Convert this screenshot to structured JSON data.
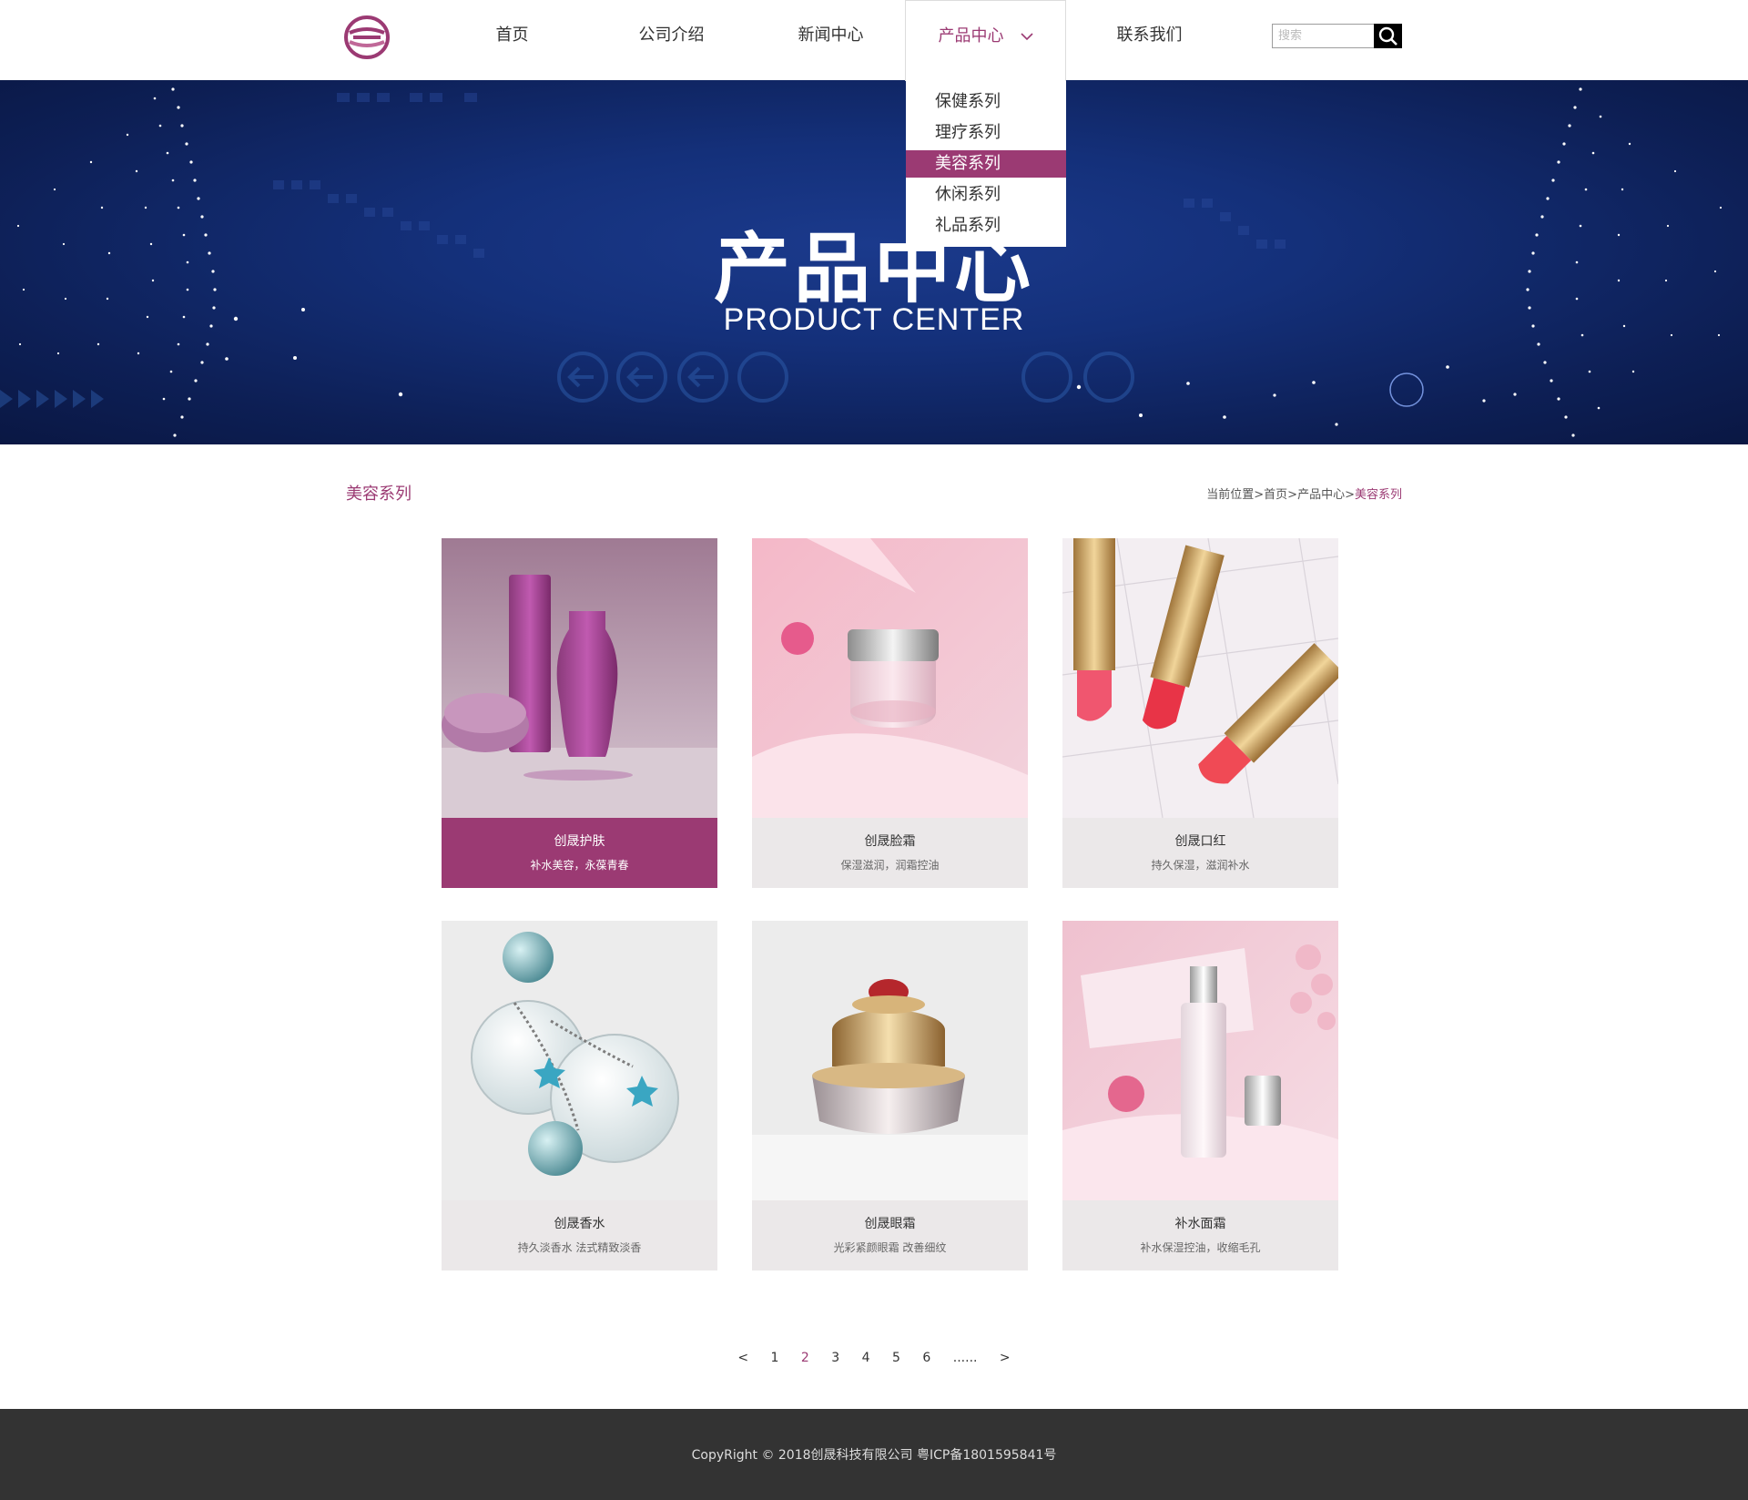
{
  "header": {
    "nav": [
      "首页",
      "公司介绍",
      "新闻中心",
      "产品中心",
      "联系我们"
    ],
    "active_nav": "产品中心",
    "search_placeholder": "搜索"
  },
  "dropdown": {
    "items": [
      "保健系列",
      "理疗系列",
      "美容系列",
      "休闲系列",
      "礼品系列"
    ],
    "active": "美容系列"
  },
  "banner": {
    "title": "产品中心",
    "subtitle": "PRODUCT CENTER"
  },
  "section": {
    "title": "美容系列",
    "breadcrumb": {
      "prefix": "当前位置",
      "sep": ">",
      "home": "首页",
      "parent": "产品中心",
      "current": "美容系列"
    }
  },
  "products": [
    {
      "name": "创晟护肤",
      "desc": "补水美容，永葆青春"
    },
    {
      "name": "创晟脸霜",
      "desc": "保湿滋润，润霜控油"
    },
    {
      "name": "创晟口红",
      "desc": "持久保湿，滋润补水"
    },
    {
      "name": "创晟香水",
      "desc": "持久淡香水 法式精致淡香"
    },
    {
      "name": "创晟眼霜",
      "desc": "光彩紧颜眼霜 改善细纹"
    },
    {
      "name": "补水面霜",
      "desc": "补水保湿控油，收缩毛孔"
    }
  ],
  "pagination": {
    "prev": "<",
    "pages": [
      "1",
      "2",
      "3",
      "4",
      "5",
      "6"
    ],
    "current": "2",
    "ellipsis": "......",
    "next": ">"
  },
  "footer": {
    "copyright": "CopyRight © 2018创晟科技有限公司 粤ICP备1801595841号"
  },
  "colors": {
    "accent": "#9b3a73",
    "banner_bg": "#14307a",
    "footer_bg": "#333333",
    "card_bg": "#ebe8e9"
  }
}
